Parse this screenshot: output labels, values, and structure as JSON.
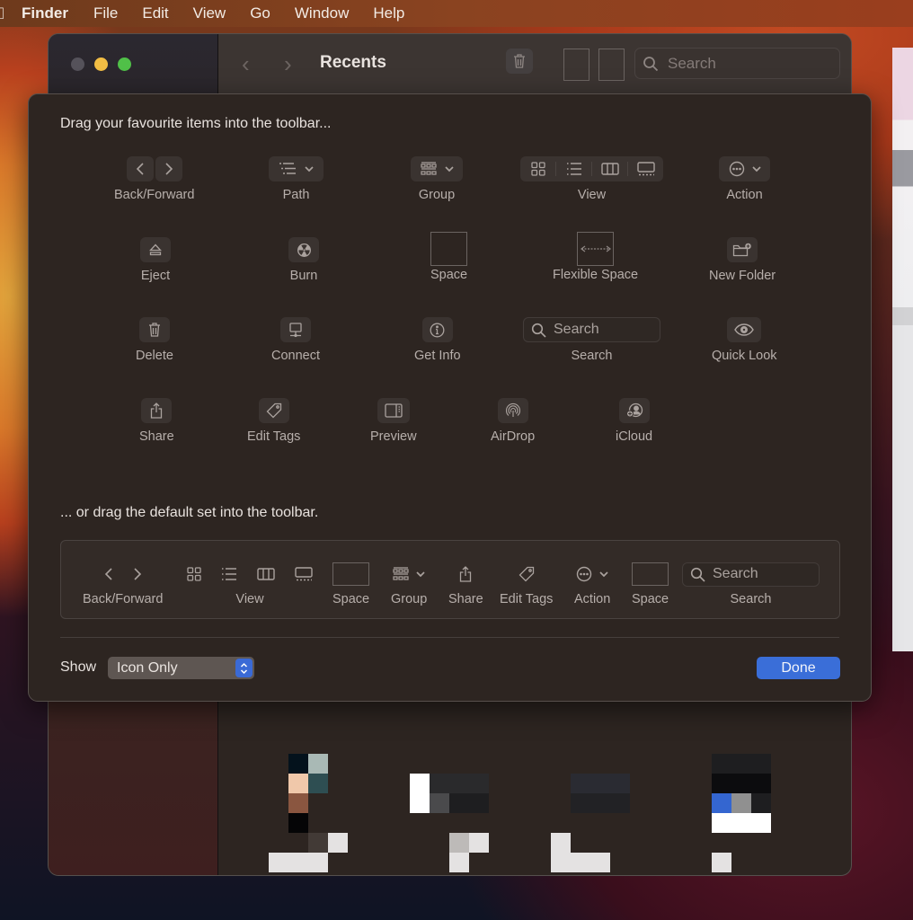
{
  "menubar": {
    "app_name": "Finder",
    "items": [
      "File",
      "Edit",
      "View",
      "Go",
      "Window",
      "Help"
    ]
  },
  "finder_window": {
    "title": "Recents",
    "search_placeholder": "Search",
    "traffic_lights": {
      "close": "#55525a",
      "minimize": "#f2bd44",
      "maximize": "#50c048"
    }
  },
  "customize_sheet": {
    "heading": "Drag your favourite items into the toolbar...",
    "items": [
      {
        "label": "Back/Forward",
        "icon": "back-forward-icon"
      },
      {
        "label": "Path",
        "icon": "path-icon"
      },
      {
        "label": "Group",
        "icon": "group-icon"
      },
      {
        "label": "View",
        "icon": "view-icon"
      },
      {
        "label": "Action",
        "icon": "action-icon"
      },
      {
        "label": "Eject",
        "icon": "eject-icon"
      },
      {
        "label": "Burn",
        "icon": "burn-icon"
      },
      {
        "label": "Space",
        "icon": "space-icon"
      },
      {
        "label": "Flexible Space",
        "icon": "flexible-space-icon"
      },
      {
        "label": "New Folder",
        "icon": "new-folder-icon"
      },
      {
        "label": "Delete",
        "icon": "trash-icon"
      },
      {
        "label": "Connect",
        "icon": "connect-icon"
      },
      {
        "label": "Get Info",
        "icon": "info-icon"
      },
      {
        "label": "Search",
        "icon": "search-icon",
        "field_placeholder": "Search"
      },
      {
        "label": "Quick Look",
        "icon": "eye-icon"
      },
      {
        "label": "Share",
        "icon": "share-icon"
      },
      {
        "label": "Edit Tags",
        "icon": "tag-icon"
      },
      {
        "label": "Preview",
        "icon": "preview-icon"
      },
      {
        "label": "AirDrop",
        "icon": "airdrop-icon"
      },
      {
        "label": "iCloud",
        "icon": "icloud-share-icon"
      }
    ],
    "default_heading": "... or drag the default set into the toolbar.",
    "default_set": [
      {
        "label": "Back/Forward"
      },
      {
        "label": "View"
      },
      {
        "label": "Space"
      },
      {
        "label": "Group"
      },
      {
        "label": "Share"
      },
      {
        "label": "Edit Tags"
      },
      {
        "label": "Action"
      },
      {
        "label": "Space"
      },
      {
        "label": "Search",
        "field_placeholder": "Search"
      }
    ],
    "show_label": "Show",
    "show_value": "Icon Only",
    "done_label": "Done",
    "accent_color": "#3a6ed8"
  }
}
